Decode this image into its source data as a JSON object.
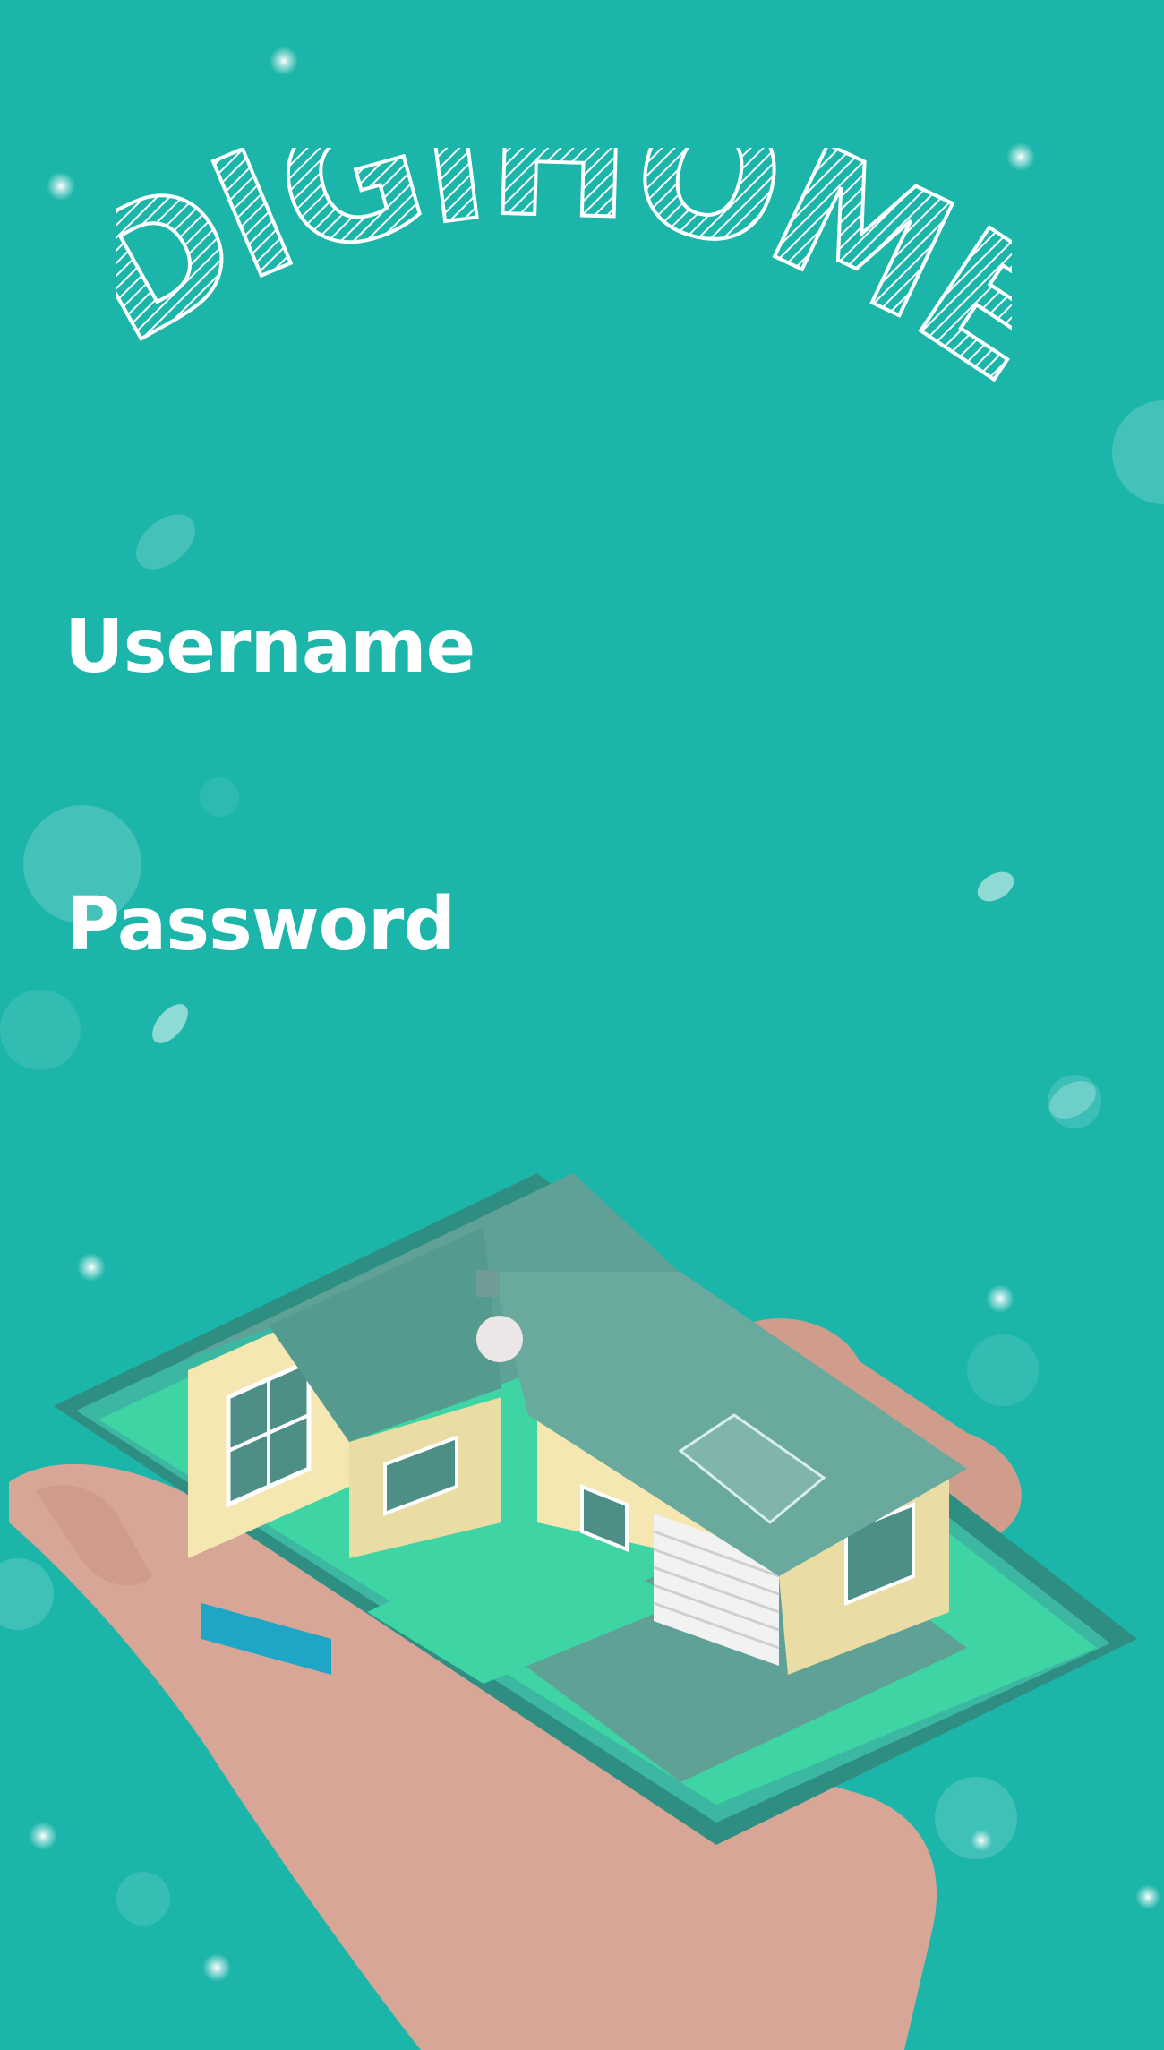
{
  "app": {
    "title": "DIGIHOME"
  },
  "form": {
    "username_label": "Username",
    "password_label": "Password",
    "username_value": "",
    "password_value": ""
  },
  "theme": {
    "background": "#1cb5aa",
    "text": "#ffffff",
    "hand": "#dba79d",
    "phone": "#3c9a8d",
    "lawn": "#3fd4a3",
    "roof": "#5fa196",
    "wall": "#f5e7b2",
    "pool": "#1fa6c6"
  },
  "illustration": {
    "icon": "hand-holding-phone-with-house-icon"
  }
}
